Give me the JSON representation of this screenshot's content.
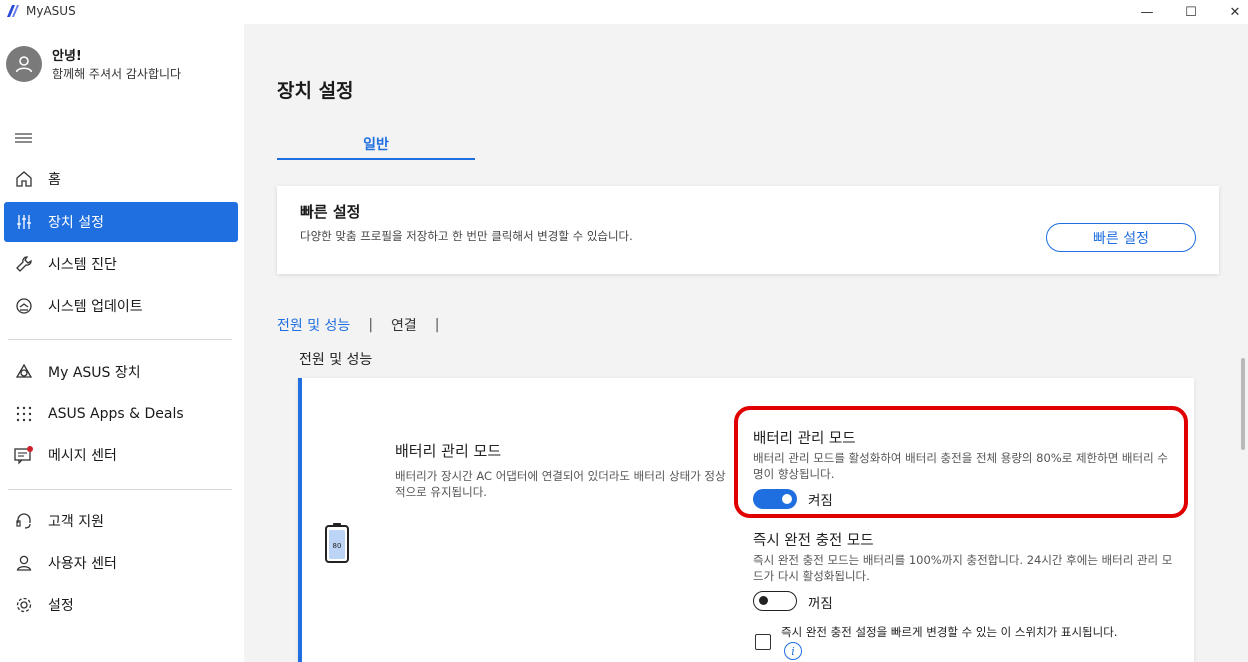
{
  "window": {
    "title": "MyASUS",
    "min_glyph": "—",
    "max_glyph": "☐",
    "close_glyph": "✕"
  },
  "user": {
    "greeting": "안녕!",
    "thanks": "함께해 주셔서 감사합니다"
  },
  "sidebar": {
    "items": [
      {
        "label": "홈",
        "icon": "home-icon"
      },
      {
        "label": "장치 설정",
        "icon": "sliders-icon",
        "active": true
      },
      {
        "label": "시스템 진단",
        "icon": "wrench-icon"
      },
      {
        "label": "시스템 업데이트",
        "icon": "update-icon"
      },
      {
        "label": "My ASUS 장치",
        "icon": "triangle-device-icon"
      },
      {
        "label": "ASUS Apps & Deals",
        "icon": "apps-grid-icon"
      },
      {
        "label": "메시지 센터",
        "icon": "message-icon"
      },
      {
        "label": "고객 지원",
        "icon": "headset-icon"
      },
      {
        "label": "사용자 센터",
        "icon": "person-icon"
      },
      {
        "label": "설정",
        "icon": "gear-icon"
      }
    ]
  },
  "main": {
    "title": "장치 설정",
    "tab_general": "일반",
    "quick_settings": {
      "title": "빠른 설정",
      "desc": "다양한 맞춤 프로필을 저장하고 한 번만 클릭해서 변경할 수 있습니다.",
      "button": "빠른 설정"
    },
    "sub_tabs": {
      "power": "전원 및 성능",
      "sep": "|",
      "connect": "연결"
    },
    "section_title": "전원 및 성능",
    "battery": {
      "icon_level": "80",
      "title": "배터리 관리 모드",
      "desc": "배터리가 장시간 AC 어댑터에 연결되어 있더라도 배터리 상태가 정상적으로 유지됩니다.",
      "mode_title": "배터리 관리 모드",
      "mode_desc": "배터리 관리 모드를 활성화하여 배터리 충전을 전체 용량의 80%로 제한하면 배터리 수명이 향상됩니다.",
      "mode_state": "켜짐",
      "instant_title": "즉시 완전 충전 모드",
      "instant_desc": "즉시 완전 충전 모드는 배터리를 100%까지 충전합니다. 24시간 후에는 배터리 관리 모드가 다시 활성화됩니다.",
      "instant_state": "꺼짐",
      "checkbox_text": "즉시 완전 충전 설정을 빠르게 변경할 수 있는 이 스위치가 표시됩니다.",
      "info_glyph": "i"
    }
  },
  "colors": {
    "accent": "#1f6fe0",
    "highlight": "#e00000"
  }
}
